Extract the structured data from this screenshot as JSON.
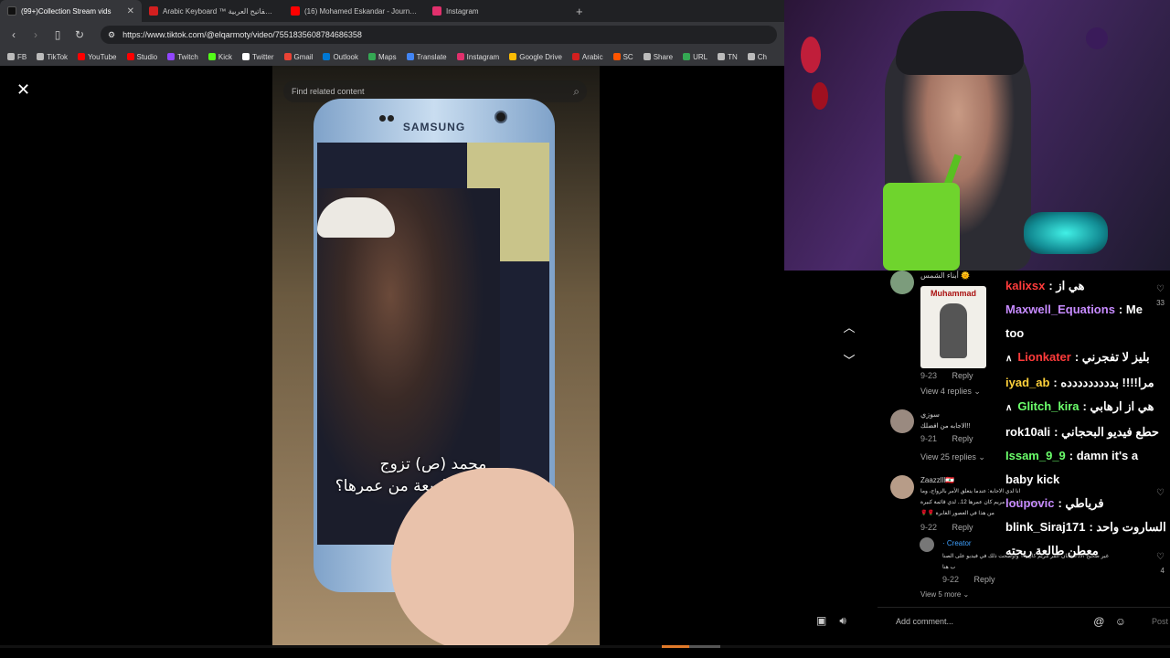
{
  "tabs": [
    {
      "title": "(99+)Collection Stream vids",
      "color": "#ffffff"
    },
    {
      "title": "Arabic Keyboard ™ لوحة المفاتيح العربية",
      "color": "#d21f1f"
    },
    {
      "title": "(16) Mohamed Eskandar - Journhou",
      "color": "#ff0000"
    },
    {
      "title": "Instagram",
      "color": "#e1306c"
    }
  ],
  "new_tab": "+",
  "url": "https://www.tiktok.com/@elqarmoty/video/7551835608784686358",
  "bookmarks": [
    {
      "label": "FB",
      "color": "#bbbbbb"
    },
    {
      "label": "TikTok",
      "color": "#bbbbbb"
    },
    {
      "label": "YouTube",
      "color": "#ff0000"
    },
    {
      "label": "Studio",
      "color": "#ff0000"
    },
    {
      "label": "Twitch",
      "color": "#9146ff"
    },
    {
      "label": "Kick",
      "color": "#53fc18"
    },
    {
      "label": "Twitter",
      "color": "#ffffff"
    },
    {
      "label": "Gmail",
      "color": "#ea4335"
    },
    {
      "label": "Outlook",
      "color": "#0078d4"
    },
    {
      "label": "Maps",
      "color": "#34a853"
    },
    {
      "label": "Translate",
      "color": "#4285f4"
    },
    {
      "label": "Instagram",
      "color": "#e1306c"
    },
    {
      "label": "Google Drive",
      "color": "#fbbc04"
    },
    {
      "label": "Arabic",
      "color": "#d21f1f"
    },
    {
      "label": "SC",
      "color": "#ff5500"
    },
    {
      "label": "Share",
      "color": "#bbbbbb"
    },
    {
      "label": "URL",
      "color": "#34a853"
    },
    {
      "label": "TN",
      "color": "#bbbbbb"
    },
    {
      "label": "Ch",
      "color": "#bbbbbb"
    }
  ],
  "search_placeholder": "Find related content",
  "video": {
    "phone_brand": "SAMSUNG",
    "caption_line1": "محمد (ص) تزوج",
    "caption_line2": "عائشة في التاسعة من عمرها؟"
  },
  "comments": [
    {
      "user": "أبناء الشمس 🌞",
      "sticker": "Muhammad",
      "date": "9-23",
      "reply": "Reply",
      "view": "View 4 replies ⌄"
    },
    {
      "user": "سوزي",
      "text": "الاجابه من افضلك!!",
      "date": "9-21",
      "reply": "Reply",
      "view": "View 25 replies ⌄"
    },
    {
      "user": "Zaazzlll🇱🇧",
      "text1": "انا لدي الاجابة: عندما يتعلق الأمر بالزواج، وما",
      "text2": "تم في عصر، كانت الصغيرات يتزوجن. السيده مريم كان عمرها 12.. لدي قائمة كبيرة",
      "text3": "🌹🌹 من هذا في العصور الغابرة",
      "date": "9-22",
      "reply": "Reply"
    },
    {
      "user": "· Creator",
      "text1": "غير صحيح الادعاء بان عمر مريم كان ١٢ وأوضحت ذلك في فيديو على الصنا",
      "text2": "ب هنا",
      "date": "9-22",
      "reply": "Reply",
      "view": "View 5 more ⌄"
    }
  ],
  "comment_counts": [
    "33",
    "4"
  ],
  "chat": [
    {
      "user": "kalixsx",
      "color": "#ff3b3b",
      "msg": ": هي از"
    },
    {
      "user": "Maxwell_Equations",
      "color": "#c78bff",
      "msg": ": Me"
    },
    {
      "user": "",
      "color": "#ffffff",
      "msg": "too"
    },
    {
      "user": "Lionkater",
      "color": "#ff3b3b",
      "msg": ": بليز لا تفجرني",
      "prefix": "∧"
    },
    {
      "user": "iyad_ab",
      "color": "#ffd23b",
      "msg": ": مرا!!!! بددددددددده"
    },
    {
      "user": "Glitch_kira",
      "color": "#6bff6b",
      "msg": ": هي از ارهابي",
      "prefix": "∧"
    },
    {
      "user": "rok10ali",
      "color": "#ffffff",
      "msg": ": حطع فيديو البحجاني"
    },
    {
      "user": "Issam_9_9",
      "color": "#6bff6b",
      "msg": ": damn it's a"
    },
    {
      "user": "",
      "color": "#ffffff",
      "msg": "baby kick"
    },
    {
      "user": "loupovic",
      "color": "#c78bff",
      "msg": ": فرياطي"
    },
    {
      "user": "blink_Siraj171",
      "color": "#ffffff",
      "msg": ": الساروت واحد"
    },
    {
      "user": "",
      "color": "#ffffff",
      "msg": "معطن طالعة ريحته"
    }
  ],
  "add_comment": "Add comment...",
  "post": "Post"
}
